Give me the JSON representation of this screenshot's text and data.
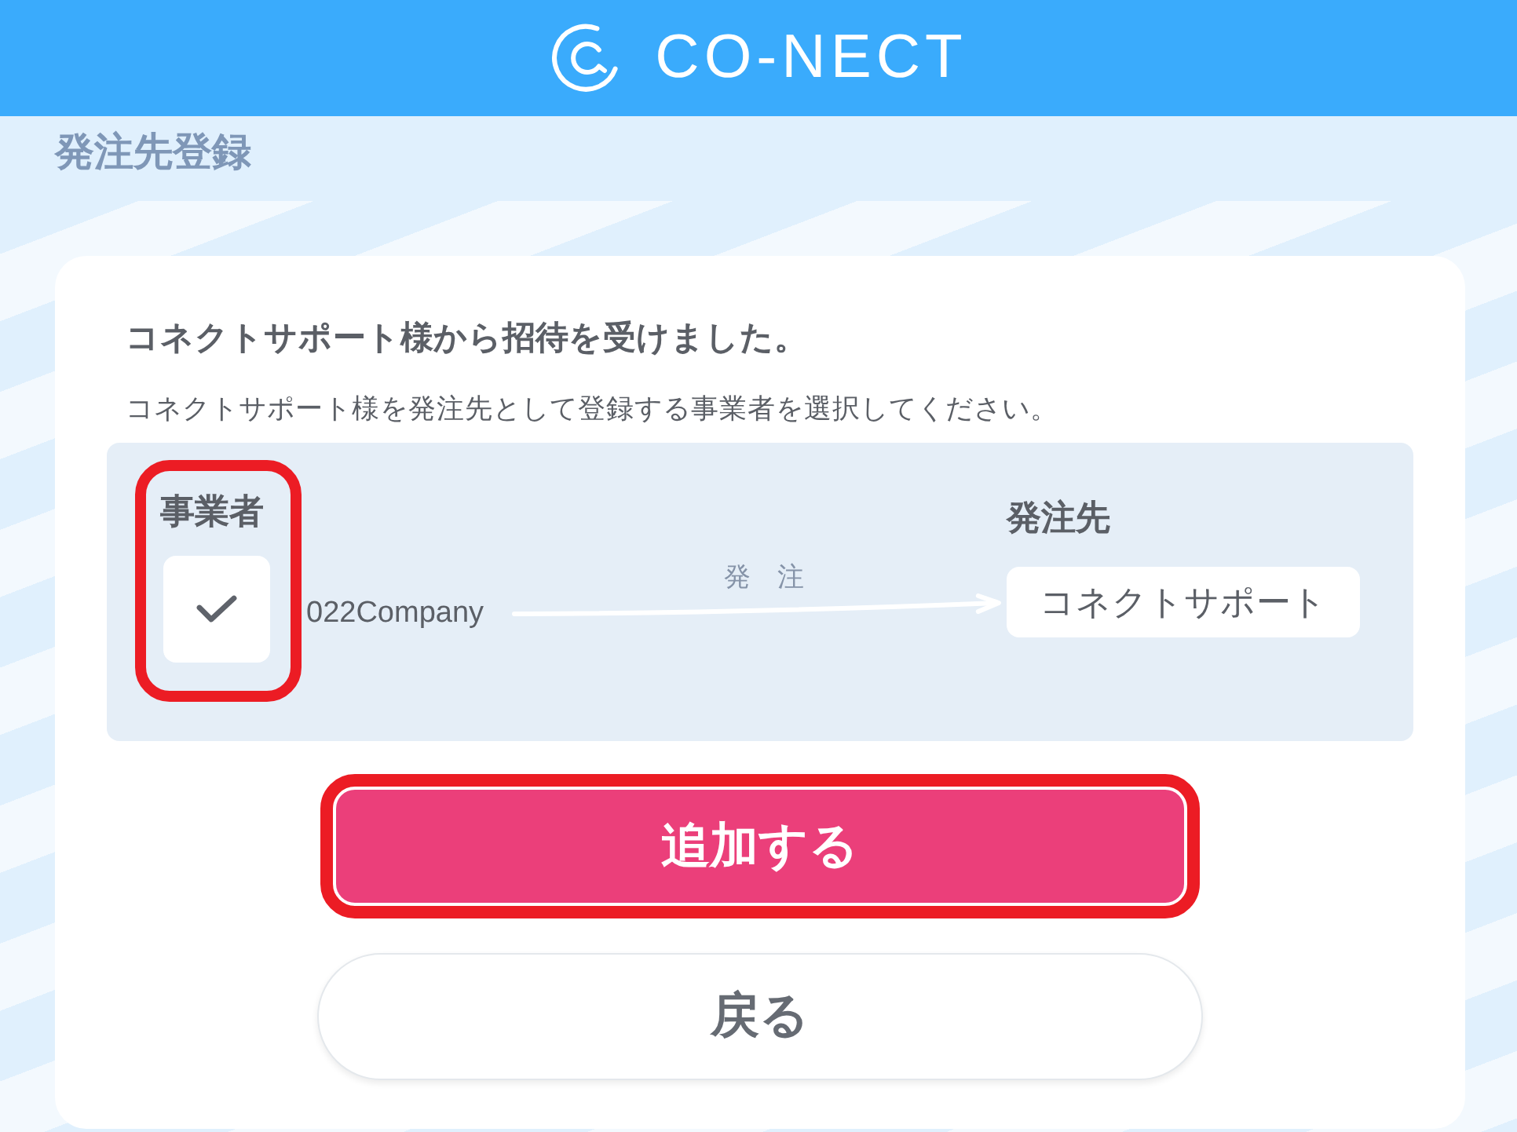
{
  "header": {
    "logo_text": "CO-NECT"
  },
  "page_title": "発注先登録",
  "card": {
    "heading": "コネクトサポート様から招待を受けました。",
    "description": "コネクトサポート様を発注先として登録する事業者を選択してください。"
  },
  "order_panel": {
    "business": {
      "label": "事業者",
      "highlighted": true,
      "checked": true,
      "company": "022Company"
    },
    "arrow_label": "発　注",
    "supplier": {
      "label": "発注先",
      "name": "コネクトサポート"
    }
  },
  "buttons": [
    {
      "kind": "primary",
      "label": "追加する",
      "highlighted": true
    },
    {
      "kind": "secondary",
      "label": "戻る",
      "highlighted": false
    }
  ]
}
